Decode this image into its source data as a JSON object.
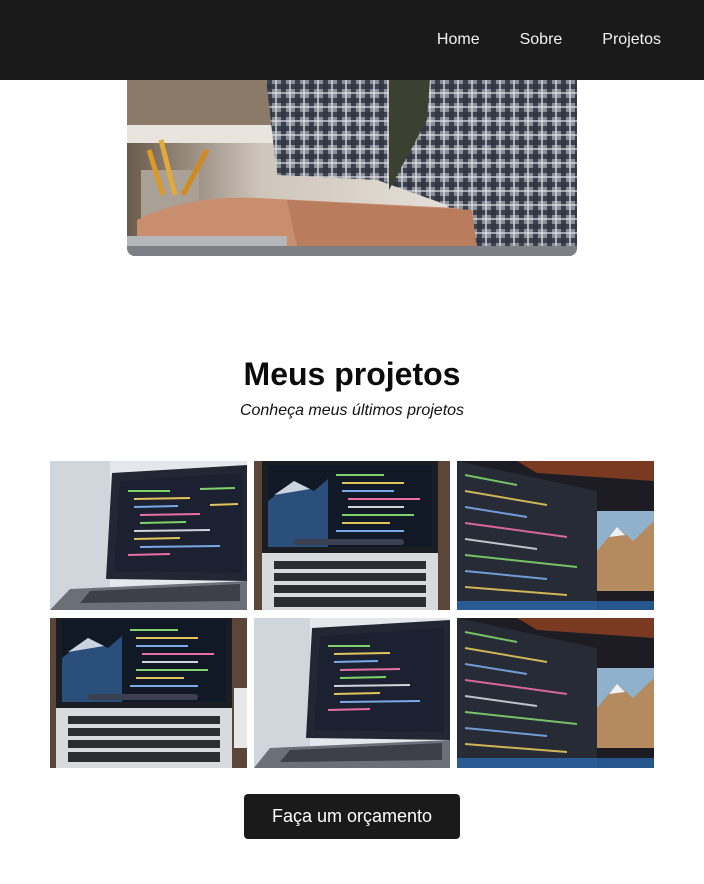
{
  "nav": {
    "items": [
      {
        "label": "Home"
      },
      {
        "label": "Sobre"
      },
      {
        "label": "Projetos"
      }
    ]
  },
  "projects": {
    "title": "Meus projetos",
    "subtitle": "Conheça meus últimos projetos",
    "cta_label": "Faça um orçamento"
  },
  "colors": {
    "header_bg": "#1a1a1a",
    "button_bg": "#1a1a1a",
    "page_bg": "#ffffff"
  }
}
